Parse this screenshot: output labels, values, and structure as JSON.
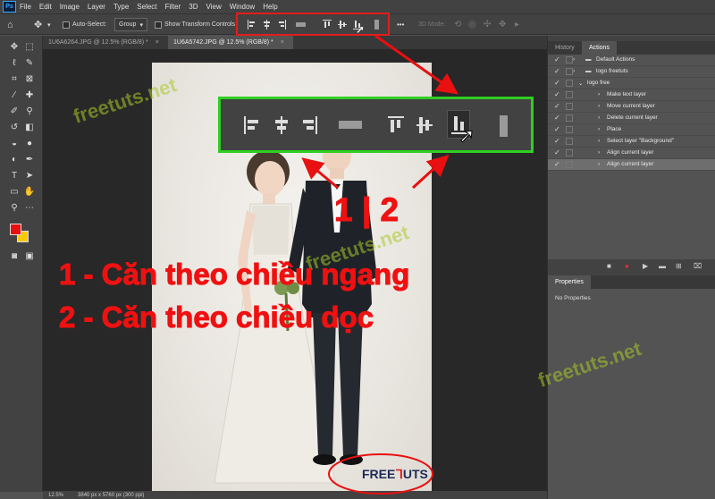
{
  "app": {
    "logo_text": "Ps"
  },
  "menu": [
    "File",
    "Edit",
    "Image",
    "Layer",
    "Type",
    "Select",
    "Filter",
    "3D",
    "View",
    "Window",
    "Help"
  ],
  "options_bar": {
    "auto_select_label": "Auto-Select:",
    "group_value": "Group",
    "transform_label": "Show Transform Controls",
    "mode_3d_label": "3D Mode:",
    "more": "•••"
  },
  "tabs": [
    {
      "label": "1U6A6264.JPG @ 12.5% (RGB/8) *",
      "close": "×"
    },
    {
      "label": "1U6A5742.JPG @ 12.5% (RGB/8) *",
      "close": "×"
    }
  ],
  "panels": {
    "history_tab": "History",
    "actions_tab": "Actions",
    "properties_tab": "Properties",
    "no_properties": "No Properties",
    "actions": [
      {
        "label": "Default Actions",
        "kind": "set"
      },
      {
        "label": "logo freetuts",
        "kind": "set"
      },
      {
        "label": "logo free",
        "kind": "action"
      },
      {
        "label": "Make text layer",
        "kind": "step"
      },
      {
        "label": "Move current layer",
        "kind": "step"
      },
      {
        "label": "Delete current layer",
        "kind": "step"
      },
      {
        "label": "Place",
        "kind": "step"
      },
      {
        "label": "Select layer \"Background\"",
        "kind": "step"
      },
      {
        "label": "Align current layer",
        "kind": "step"
      },
      {
        "label": "Align current layer",
        "kind": "step",
        "selected": true
      }
    ]
  },
  "status": {
    "zoom": "12.5%",
    "doc_info": "3840 px x 5760 px (300 ppi)"
  },
  "annotations": {
    "numbers": "1 | 2",
    "line1": "1 - Căn theo chiều ngang",
    "line2": "2 - Căn theo chiều dọc"
  },
  "watermarks": {
    "site": "freetuts.net",
    "logo_left": "FREE",
    "logo_right": "UTS"
  },
  "colors": {
    "foreground": "#e81010",
    "background": "#f8c800",
    "annotation_red": "#ef1111",
    "inset_green": "#2fcf22"
  }
}
